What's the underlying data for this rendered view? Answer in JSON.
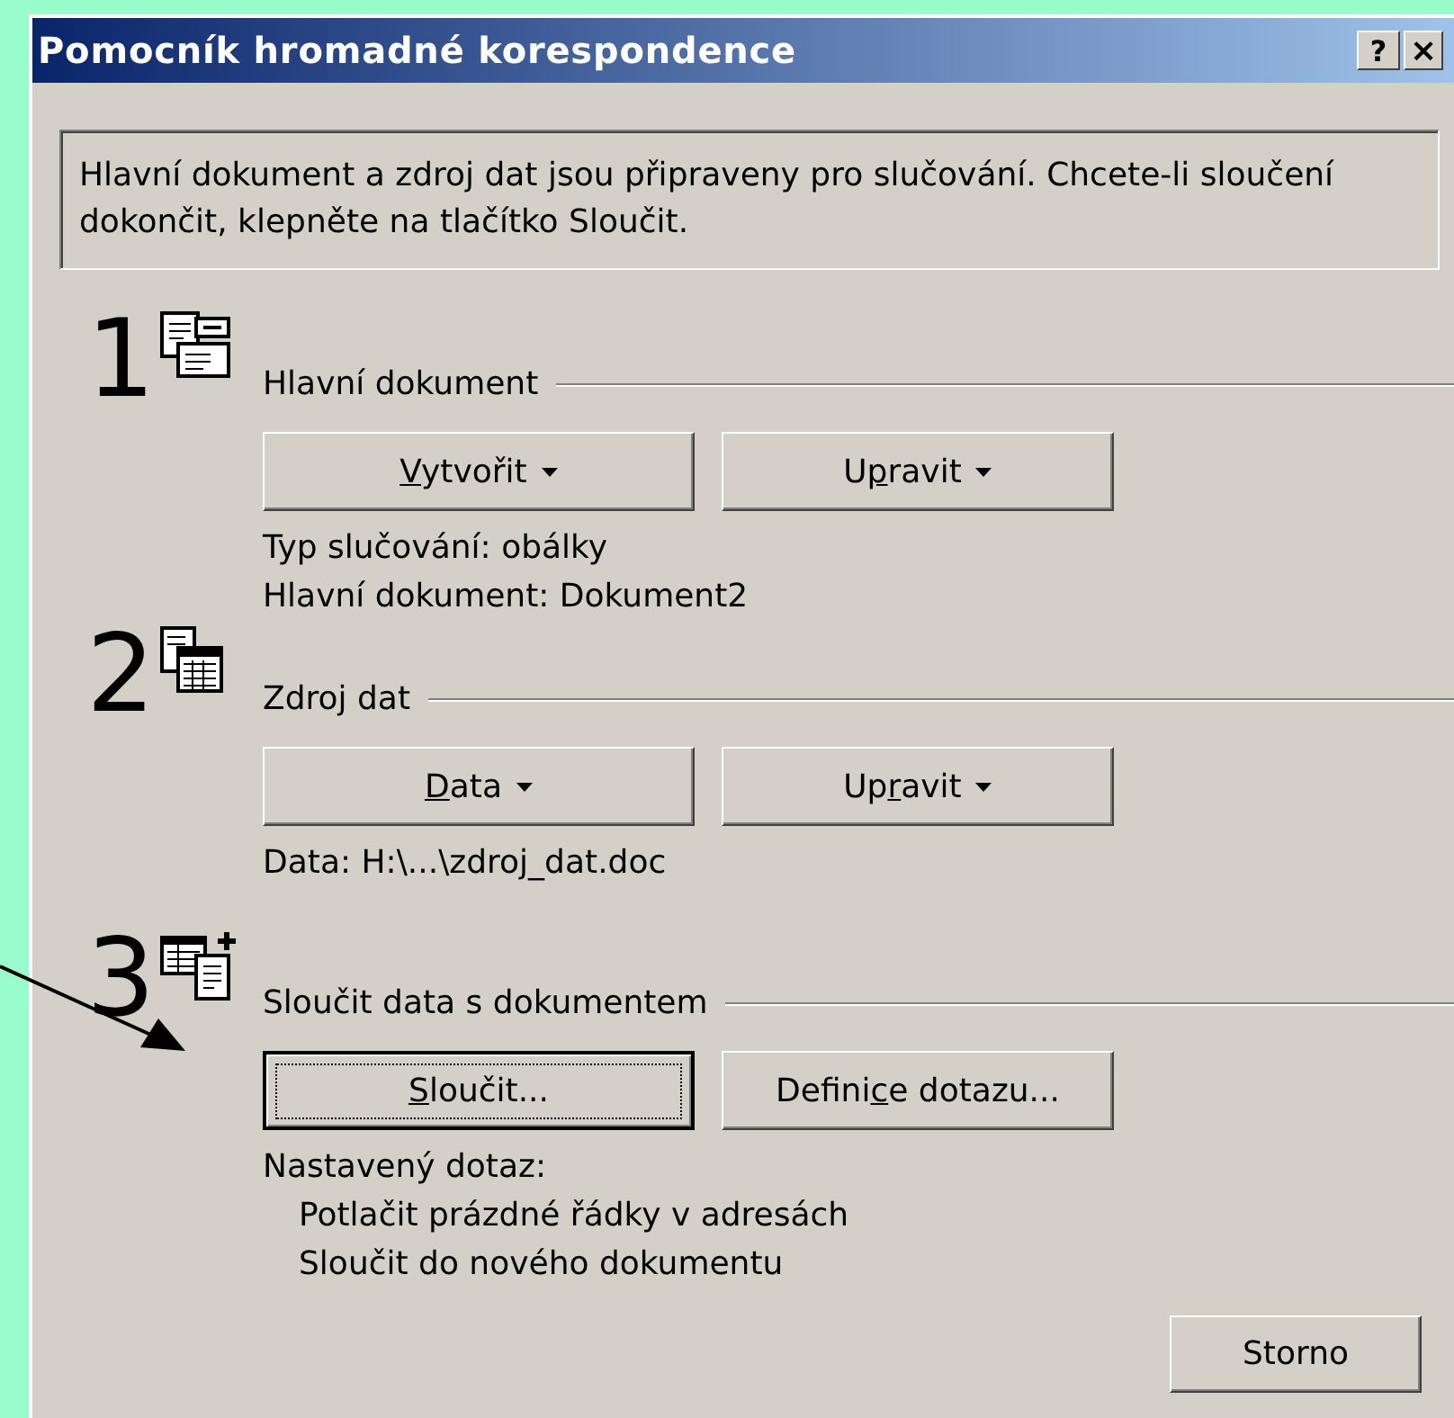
{
  "window": {
    "title": "Pomocník hromadné korespondence",
    "title_buttons": [
      {
        "kind": "help",
        "label": "?"
      },
      {
        "kind": "close",
        "label": "×"
      }
    ]
  },
  "message": "Hlavní dokument a zdroj dat jsou připraveny pro slučování. Chcete-li sloučení dokončit, klepněte na tlačítko Sloučit.",
  "sections": [
    {
      "number": "1",
      "kind": "main-document",
      "label": "Hlavní dokument",
      "buttons": [
        {
          "key": "V",
          "after": "ytvořit",
          "dropdown": true,
          "default": false
        },
        {
          "before": "U",
          "key": "p",
          "after": "ravit",
          "dropdown": true,
          "default": false
        }
      ],
      "info": [
        {
          "text": "Typ slučování: obálky",
          "indented": false
        },
        {
          "text": "Hlavní dokument: Dokument2",
          "indented": false
        }
      ]
    },
    {
      "number": "2",
      "kind": "data-source",
      "label": "Zdroj dat",
      "buttons": [
        {
          "key": "D",
          "after": "ata",
          "dropdown": true,
          "default": false
        },
        {
          "before": "Up",
          "key": "r",
          "after": "avit",
          "dropdown": true,
          "default": false
        }
      ],
      "info": [
        {
          "text": "Data: H:\\...\\zdroj_dat.doc",
          "indented": false
        }
      ]
    },
    {
      "number": "3",
      "kind": "merge",
      "label": "Sloučit data s dokumentem",
      "buttons": [
        {
          "key": "S",
          "after": "loučit...",
          "dropdown": false,
          "default": true
        },
        {
          "before": "Defini",
          "key": "c",
          "after": "e dotazu...",
          "dropdown": false,
          "default": false
        }
      ],
      "info": [
        {
          "text": "Nastavený dotaz:",
          "indented": false
        },
        {
          "text": "Potlačit prázdné řádky v adresách",
          "indented": true
        },
        {
          "text": "Sloučit do nového dokumentu",
          "indented": true
        }
      ]
    }
  ],
  "footer_buttons": [
    "Storno"
  ]
}
